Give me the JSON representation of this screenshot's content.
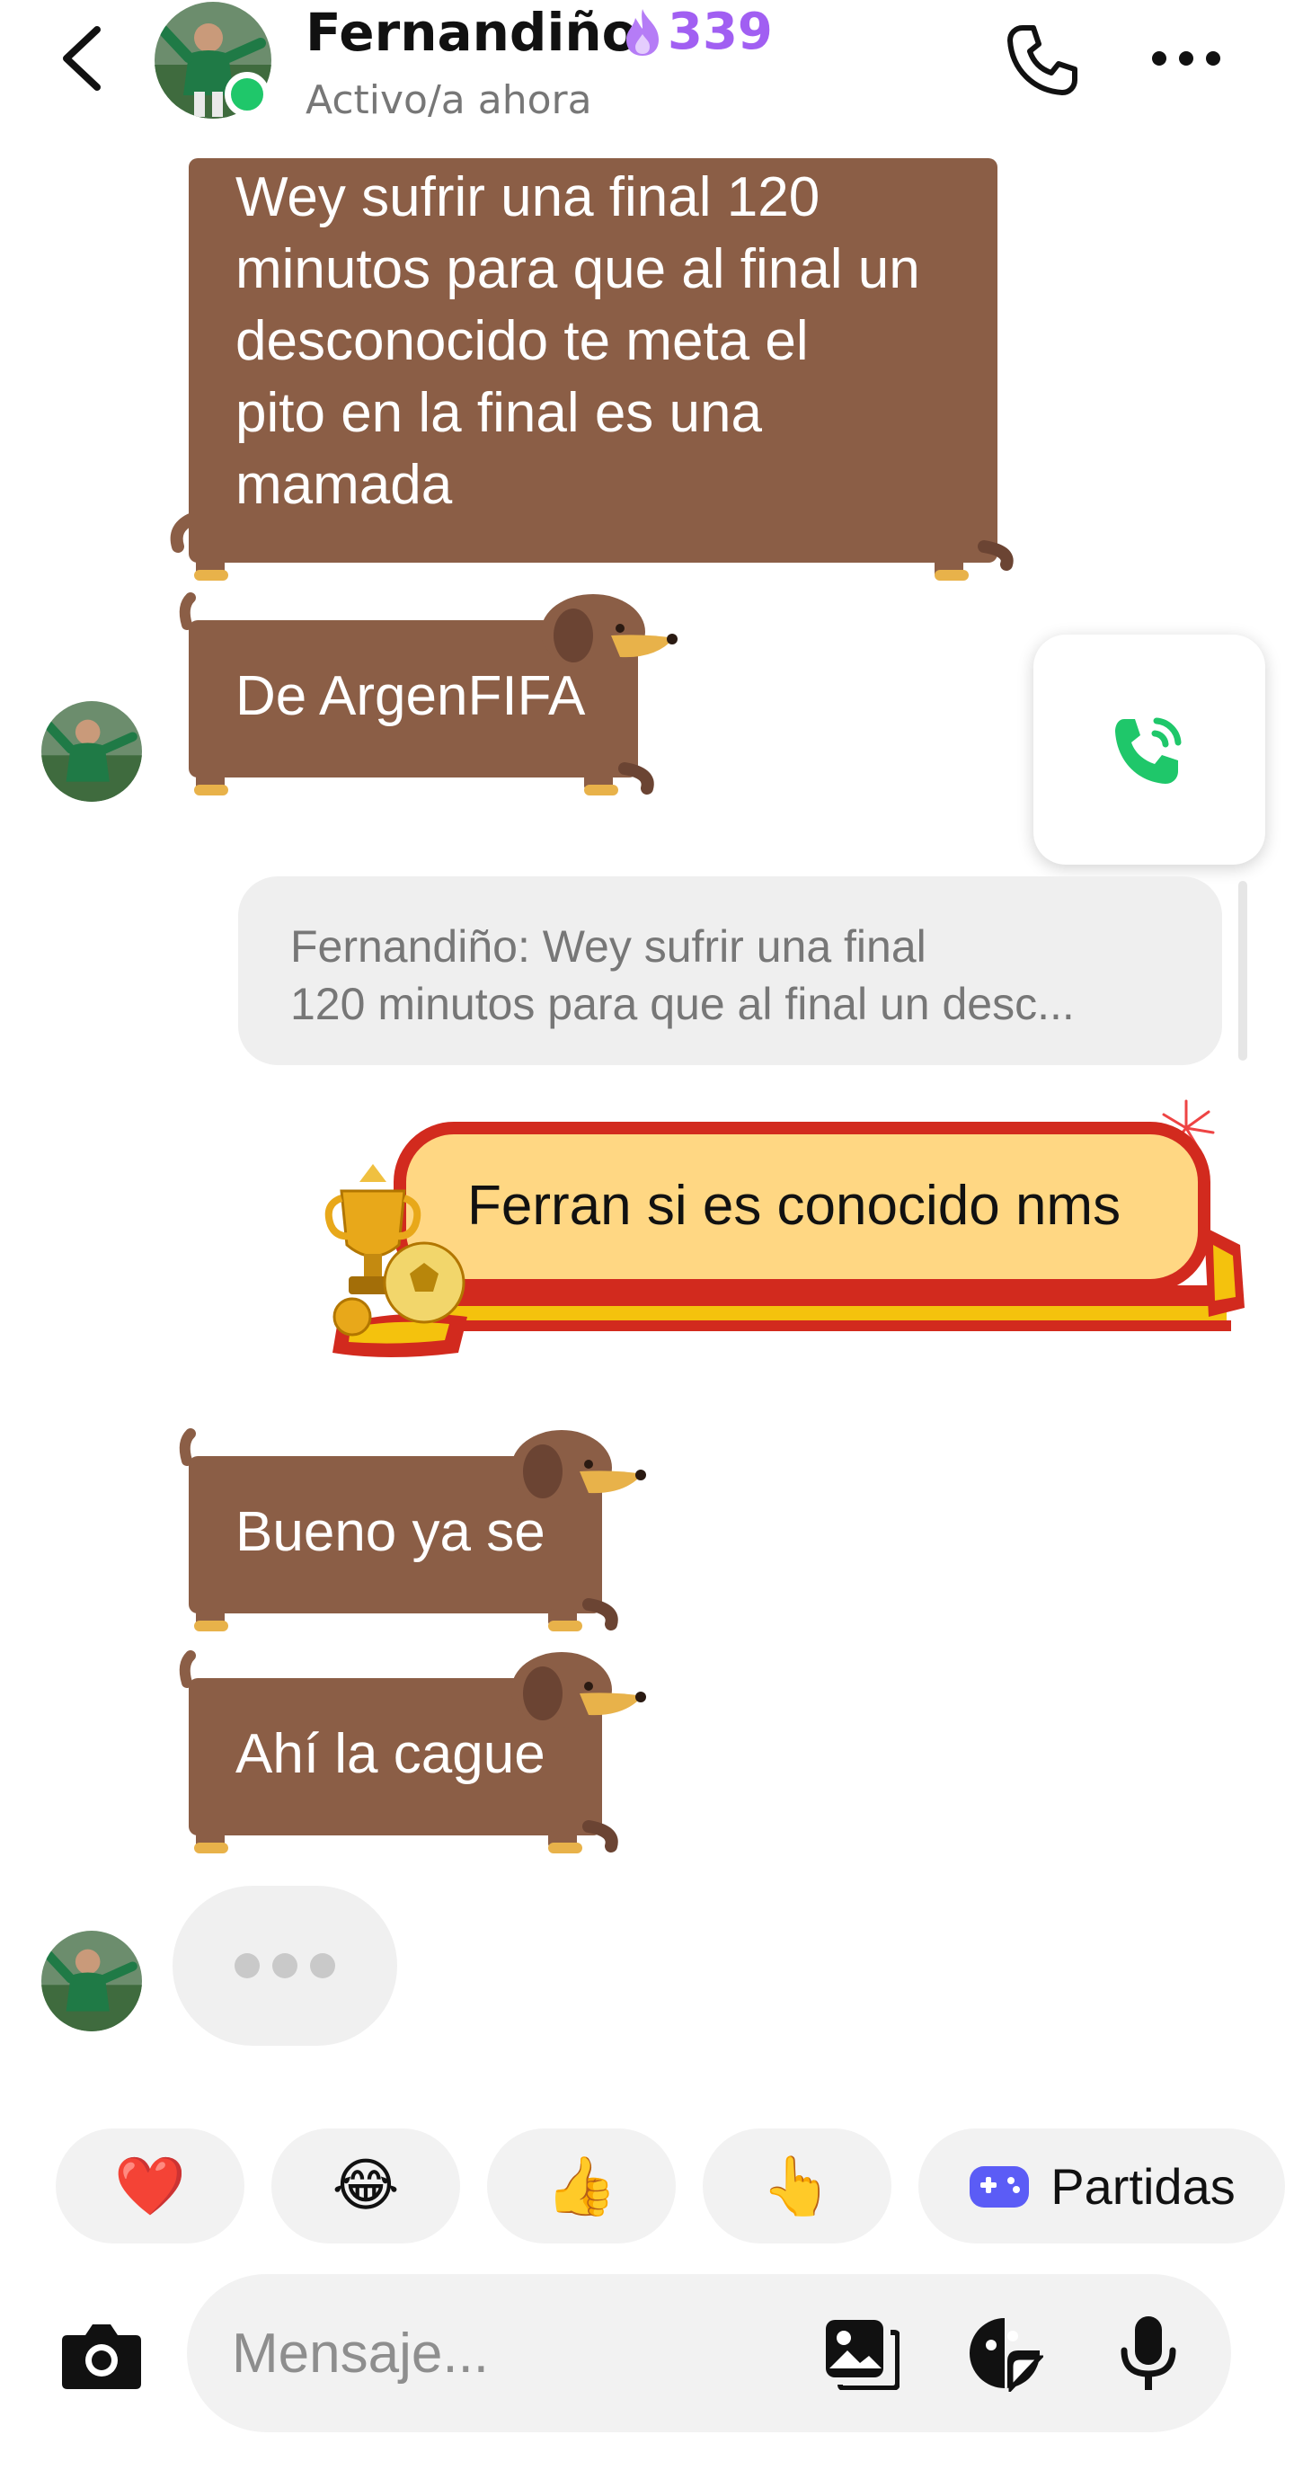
{
  "header": {
    "contact_name": "Fernandiño",
    "streak_count": "339",
    "status": "Activo/a ahora",
    "icons": {
      "back": "chevron-left-icon",
      "call": "phone-icon",
      "more": "more-horizontal-icon",
      "streak": "flame-icon"
    },
    "online_color": "#1fc76a",
    "streak_color": "#a15ff2"
  },
  "messages": [
    {
      "sender": "Fernandiño",
      "direction": "incoming",
      "style": "sausage-dog",
      "lines": [
        "Wey sufrir una final 120",
        "minutos para que al final un",
        "desconocido te meta el",
        "pito en la final es una",
        "mamada"
      ]
    },
    {
      "sender": "Fernandiño",
      "direction": "incoming",
      "style": "sausage-dog",
      "text": "De ArgenFIFA"
    },
    {
      "direction": "outgoing",
      "style": "trophy-spain",
      "reply_to": {
        "line1": "Fernandiño: Wey sufrir una final",
        "line2": "120 minutos para que al final un desc..."
      },
      "text": "Ferran si es conocido nms"
    },
    {
      "sender": "Fernandiño",
      "direction": "incoming",
      "style": "sausage-dog",
      "text": "Bueno ya se"
    },
    {
      "sender": "Fernandiño",
      "direction": "incoming",
      "style": "sausage-dog",
      "text": "Ahí la cague"
    }
  ],
  "call_widget": {
    "icon": "phone-call-icon",
    "color": "#1fc76a"
  },
  "typing_indicator": {
    "icon": "typing-dots"
  },
  "quick_reactions": [
    {
      "emoji": "❤️",
      "name": "heart"
    },
    {
      "emoji": "😂",
      "name": "tears-of-joy"
    },
    {
      "emoji": "👍",
      "name": "thumbs-up"
    },
    {
      "emoji": "👆",
      "name": "pointing-up"
    }
  ],
  "games_button": {
    "label": "Partidas",
    "icon": "gamepad-icon",
    "color": "#5b5cf6"
  },
  "composer": {
    "placeholder": "Mensaje...",
    "icons": {
      "camera": "camera-icon",
      "gallery": "gallery-icon",
      "sticker": "sticker-icon",
      "mic": "microphone-icon"
    }
  },
  "colors": {
    "dog_bubble": "#8b5e46",
    "themed_bubble_fill": "#ffd783",
    "themed_bubble_border": "#d22a1e",
    "spain_yellow": "#f4c20d",
    "background": "#ffffff"
  }
}
